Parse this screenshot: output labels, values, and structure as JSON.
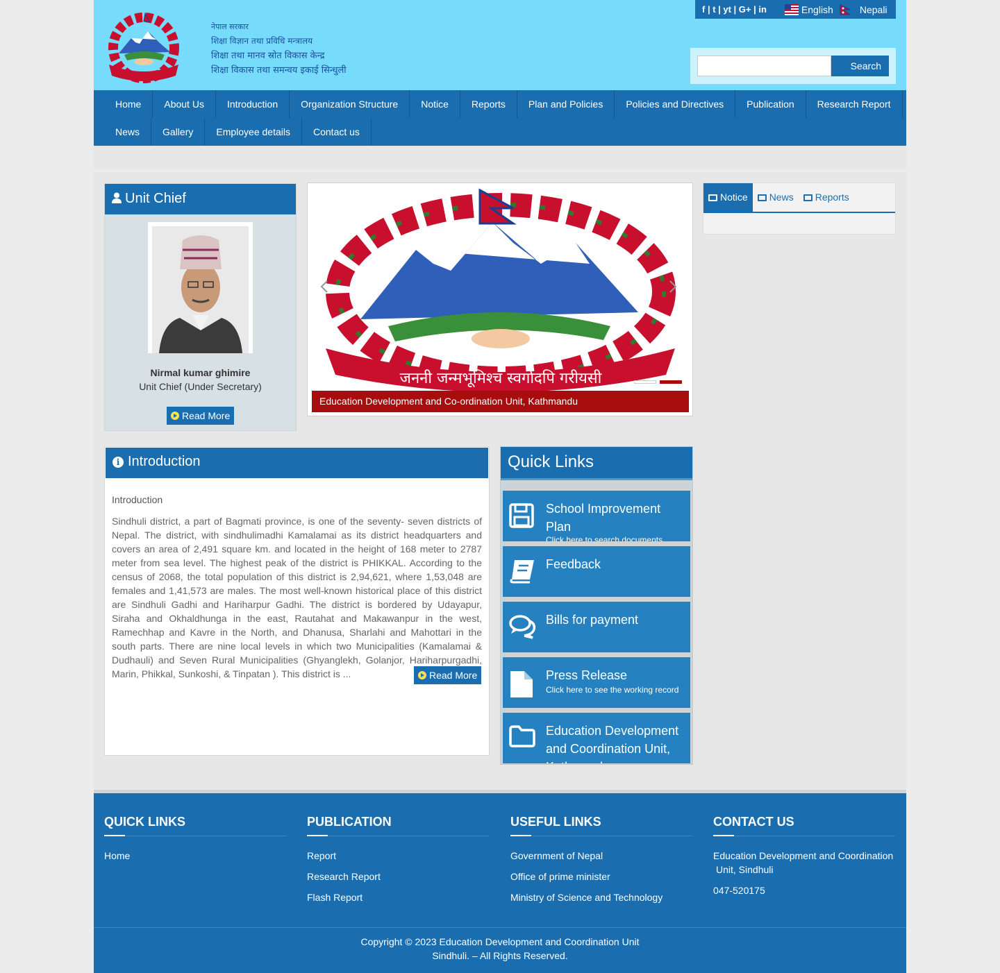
{
  "header": {
    "line1": "नेपाल सरकार",
    "line2": "शिक्षा विज्ञान तथा प्रविधि मन्त्रालय",
    "line3": "शिक्षा तथा मानव स्रोत विकास केन्द्र",
    "line4": "शिक्षा विकास तथा समन्वय इकाई सिन्धुली"
  },
  "topbar": {
    "social": "f | t | yt | G+ | in",
    "english": "English",
    "nepali": "Nepali"
  },
  "search": {
    "button": "Search",
    "value": ""
  },
  "nav": {
    "row1": [
      "Home",
      "About Us",
      "Introduction",
      "Organization Structure",
      "Notice",
      "Reports",
      "Plan and Policies",
      "Policies and Directives",
      "Publication",
      "Research Report"
    ],
    "row2": [
      "News",
      "Gallery",
      "Employee details",
      "Contact us"
    ]
  },
  "chief": {
    "heading": "Unit Chief",
    "name": "Nirmal kumar ghimire",
    "role": "Unit Chief (Under Secretary)",
    "read_more": "Read More"
  },
  "slider": {
    "caption": "Education Development and Co-ordination Unit, Kathmandu",
    "emblem_text": "जननी जन्मभूमिश्च स्वर्गादपि गरीयसी"
  },
  "tabs": [
    "Notice",
    "News",
    "Reports"
  ],
  "intro": {
    "heading": "Introduction",
    "label": "Introduction",
    "text": "Sindhuli district, a part of Bagmati province, is one of the seventy- seven districts of Nepal. The district, with sindhulimadhi Kamalamai as its district headquarters and covers an area of 2,491 square km. and located in the height of 168 meter to 2787 meter from sea level. The highest peak of the district is PHIKKAL. According to the census of 2068, the total population of this district is 2,94,621, where 1,53,048 are females and 1,41,573 are males. The most well-known historical place of this district are Sindhuli Gadhi and Hariharpur Gadhi. The district is bordered by Udayapur, Siraha and Okhaldhunga in the east, Rautahat and Makawanpur in the west, Ramechhap and Kavre in the North, and Dhanusa, Sharlahi and Mahottari in the south parts. There are nine local levels in which two Municipalities (Kamalamai & Dudhauli) and Seven Rural Municipalities (Ghyanglekh, Golanjor, Hariharpurgadhi, Marin, Phikkal, Sunkoshi, & Tinpatan ). This district is ...",
    "read_more": "Read More"
  },
  "quick_links": {
    "heading": "Quick Links",
    "items": [
      {
        "title": "School Improvement Plan",
        "sub": "Click here to search documents",
        "icon": "save-icon"
      },
      {
        "title": "Feedback",
        "sub": "",
        "icon": "book-icon"
      },
      {
        "title": "Bills for payment",
        "sub": "",
        "icon": "comments-icon"
      },
      {
        "title": "Press Release",
        "sub": "Click here to see the working record",
        "icon": "file-icon"
      },
      {
        "title": "Education Development and Coordination Unit, Kathmandu",
        "sub": "",
        "icon": "folder-icon"
      }
    ]
  },
  "footer": {
    "quick_links": {
      "heading": "QUICK LINKS",
      "items": [
        "Home"
      ]
    },
    "publication": {
      "heading": "PUBLICATION",
      "items": [
        "Report",
        "Research Report",
        "Flash Report"
      ]
    },
    "useful_links": {
      "heading": "USEFUL LINKS",
      "items": [
        "Government of Nepal",
        "Office of prime minister",
        "Ministry of Science and Technology"
      ]
    },
    "contact": {
      "heading": "CONTACT US",
      "address": "Education Development and Coordination Unit, Sindhuli",
      "phone": "047-520175"
    },
    "copyright_line1": "Copyright © 2023 Education Development and Coordination Unit",
    "copyright_line2": "Sindhuli. – All Rights Reserved."
  },
  "colors": {
    "header_bg": "#77dcfb",
    "primary": "#1a6eb0",
    "caption_red": "#a80d0d"
  }
}
